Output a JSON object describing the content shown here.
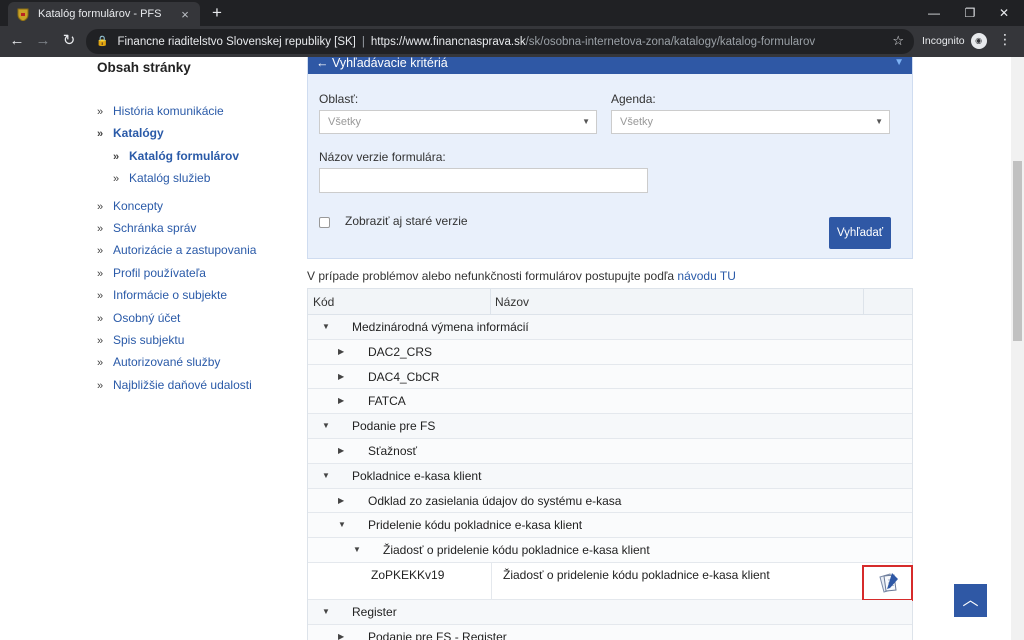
{
  "browser": {
    "tab_title": "Katalóg formulárov - PFS",
    "url_org": "Financne riaditelstvo Slovenskej republiky [SK]",
    "url_host": "https://www.financnasprava.sk",
    "url_path": "/sk/osobna-internetova-zona/katalogy/katalog-formularov",
    "incognito_label": "Incognito"
  },
  "sidebar": {
    "title": "Obsah stránky",
    "items": [
      {
        "label": "História komunikácie"
      },
      {
        "label": "Katalógy"
      },
      {
        "label": "Katalóg formulárov"
      },
      {
        "label": "Katalóg služieb"
      },
      {
        "label": "Koncepty"
      },
      {
        "label": "Schránka správ"
      },
      {
        "label": "Autorizácie a zastupovania"
      },
      {
        "label": "Profil používateľa"
      },
      {
        "label": "Informácie o subjekte"
      },
      {
        "label": "Osobný účet"
      },
      {
        "label": "Spis subjektu"
      },
      {
        "label": "Autorizované služby"
      },
      {
        "label": "Najbližšie daňové udalosti"
      }
    ]
  },
  "search": {
    "header": "Vyhľadávacie kritériá",
    "oblast_label": "Oblasť:",
    "oblast_value": "Všetky",
    "agenda_label": "Agenda:",
    "agenda_value": "Všetky",
    "name_label": "Názov verzie formulára:",
    "name_value": "",
    "old_versions_label": "Zobraziť aj staré verzie",
    "search_button": "Vyhľadať"
  },
  "notice": {
    "text": "V prípade problémov alebo nefunkčnosti formulárov postupujte podľa",
    "link": "návodu TU"
  },
  "table": {
    "col_code": "Kód",
    "col_name": "Názov",
    "rows": [
      {
        "label": "Medzinárodná výmena informácií"
      },
      {
        "label": "DAC2_CRS"
      },
      {
        "label": "DAC4_CbCR"
      },
      {
        "label": "FATCA"
      },
      {
        "label": "Podanie pre FS"
      },
      {
        "label": "Sťažnosť"
      },
      {
        "label": "Pokladnice e-kasa klient"
      },
      {
        "label": "Odklad zo zasielania údajov do systému e-kasa"
      },
      {
        "label": "Pridelenie kódu pokladnice e-kasa klient"
      },
      {
        "label": "Žiadosť o pridelenie kódu pokladnice e-kasa klient"
      },
      {
        "code": "ZoPKEKKv19",
        "label": "Žiadosť o pridelenie kódu pokladnice e-kasa klient"
      },
      {
        "label": "Register"
      },
      {
        "label": "Podanie pre FS - Register"
      }
    ]
  },
  "colors": {
    "primary": "#2f58a5",
    "link": "#2a5aa8",
    "panel_bg": "#e9f0fb",
    "highlight": "#d62b2b"
  }
}
